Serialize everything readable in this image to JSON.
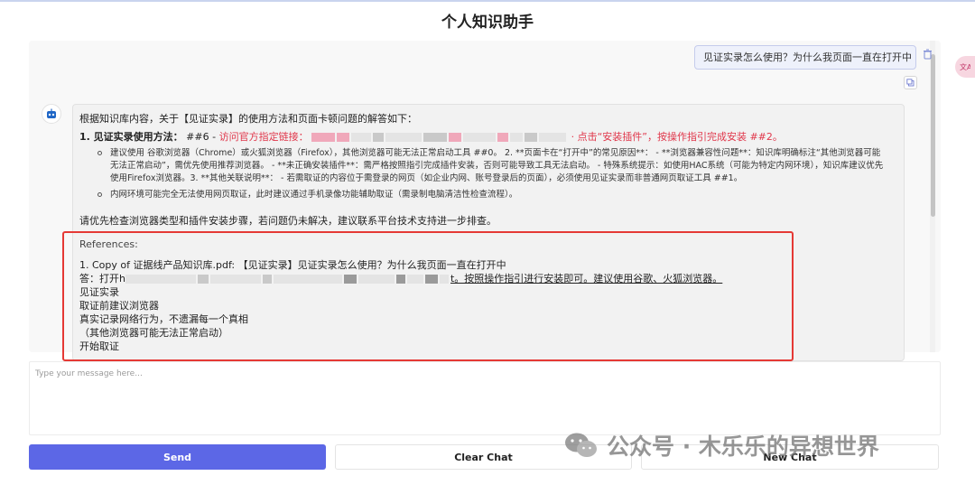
{
  "app": {
    "title": "个人知识助手"
  },
  "user_message": {
    "text": "见证实录怎么使用？为什么我页面一直在打开中"
  },
  "bot_message": {
    "intro": "根据知识库内容，关于【见证实录】的使用方法和页面卡顿问题的解答如下：",
    "step1_label": "1. 见证实录使用方法：",
    "step1_ref": "##6 -",
    "step1_link_label": "访问官方指定链接：",
    "step1_tail": "· 点击“安装插件”，按操作指引完成安装 ##2。",
    "bullet1_line1": "建议使用 谷歌浏览器（Chrome）或火狐浏览器（Firefox），其他浏览器可能无法正常启动工具 ##0。 2. **页面卡在“打开中”的常见原因**：  - **浏览器兼容性问题**：知识库明确标注“其他浏览器可能",
    "bullet1_line2": "无法正常启动”，需优先使用推荐浏览器。 - **未正确安装插件**：需严格按照指引完成插件安装，否则可能导致工具无法启动。 - 特殊系统提示：如使用HAC系统（可能为特定内网环境），知识库建议优先",
    "bullet1_line3": "使用Firefox浏览器。3. **其他关联说明**：  - 若需取证的内容位于需登录的网页（如企业内网、账号登录后的页面），必须使用见证实录而非普通网页取证工具 ##1。",
    "bullet2": "内网环境可能完全无法使用网页取证，此时建议通过手机录像功能辅助取证（需录制电脑清洁性检查流程）。",
    "closing": "请优先检查浏览器类型和插件安装步骤，若问题仍未解决，建议联系平台技术支持进一步排查。",
    "references_label": "References:",
    "ref_line1": "1. Copy of 证据线产品知识库.pdf: 【见证实录】见证实录怎么使用？为什么我页面一直在打开中",
    "ref_line2_start": "答：打开h",
    "ref_line2_end": "t。按照操作指引进行安装即可。建议使用谷歌、火狐浏览器。",
    "ref_line3": "见证实录",
    "ref_line4": "取证前建议浏览器",
    "ref_line5": "真实记录网络行为，不遗漏每一个真相",
    "ref_line6": "（其他浏览器可能无法正常启动）",
    "ref_line7": "开始取证"
  },
  "input": {
    "placeholder": "Type your message here..."
  },
  "buttons": {
    "send": "Send",
    "clear": "Clear Chat",
    "new": "New Chat"
  },
  "watermark": {
    "text": "公众号 · 木乐乐的异想世界"
  },
  "icons": {
    "trash": "trash-icon",
    "copy": "copy-icon",
    "avatar": "bot-avatar-icon",
    "badge": "translate-badge-icon",
    "wechat": "wechat-icon"
  },
  "colors": {
    "accent": "#5c67e6",
    "link_red": "#e0364a",
    "highlight": "#e53935"
  }
}
